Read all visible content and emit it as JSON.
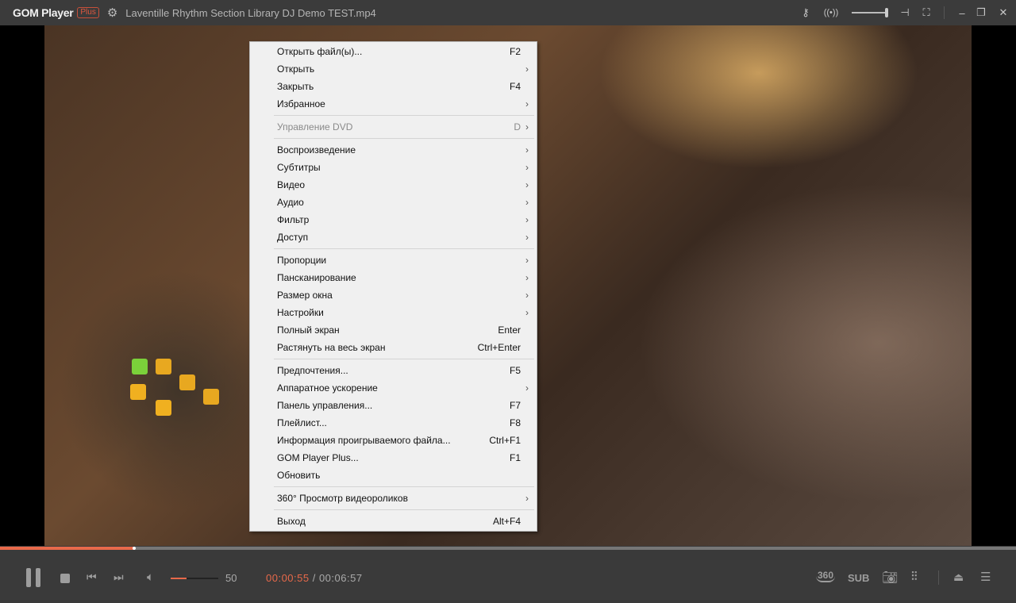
{
  "app": {
    "logo": "GOM Player",
    "logo_badge": "Plus",
    "file_title": "Laventille Rhythm Section Library DJ Demo TEST.mp4"
  },
  "titlebar_icons": [
    "settings-gear-icon",
    "key-icon",
    "broadcast-icon",
    "opacity-slider",
    "pin-icon",
    "fullscreen-icon",
    "minimize-icon",
    "restore-icon",
    "close-icon"
  ],
  "menu": [
    {
      "label": "Открыть файл(ы)...",
      "shortcut": "F2"
    },
    {
      "label": "Открыть",
      "submenu": true
    },
    {
      "label": "Закрыть",
      "shortcut": "F4"
    },
    {
      "label": "Избранное",
      "submenu": true
    },
    {
      "separator": true
    },
    {
      "label": "Управление DVD",
      "shortcut": "D",
      "submenu": true,
      "disabled": true
    },
    {
      "separator": true
    },
    {
      "label": "Воспроизведение",
      "submenu": true
    },
    {
      "label": "Субтитры",
      "submenu": true
    },
    {
      "label": "Видео",
      "submenu": true
    },
    {
      "label": "Аудио",
      "submenu": true
    },
    {
      "label": "Фильтр",
      "submenu": true
    },
    {
      "label": "Доступ",
      "submenu": true
    },
    {
      "separator": true
    },
    {
      "label": "Пропорции",
      "submenu": true
    },
    {
      "label": "Пансканирование",
      "submenu": true
    },
    {
      "label": "Размер окна",
      "submenu": true
    },
    {
      "label": "Настройки",
      "submenu": true
    },
    {
      "label": "Полный экран",
      "shortcut": "Enter"
    },
    {
      "label": "Растянуть на весь экран",
      "shortcut": "Ctrl+Enter"
    },
    {
      "separator": true
    },
    {
      "label": "Предпочтения...",
      "shortcut": "F5"
    },
    {
      "label": "Аппаратное ускорение",
      "submenu": true
    },
    {
      "label": "Панель управления...",
      "shortcut": "F7"
    },
    {
      "label": "Плейлист...",
      "shortcut": "F8"
    },
    {
      "label": "Информация проигрываемого файла...",
      "shortcut": "Ctrl+F1"
    },
    {
      "label": "GOM Player Plus...",
      "shortcut": "F1"
    },
    {
      "label": "Обновить"
    },
    {
      "separator": true
    },
    {
      "label": "360° Просмотр видеороликов",
      "submenu": true
    },
    {
      "separator": true
    },
    {
      "label": "Выход",
      "shortcut": "Alt+F4"
    }
  ],
  "playback": {
    "progress_percent": 13.2,
    "volume": 50,
    "current_time": "00:00:55",
    "separator": " / ",
    "total_time": "00:06:57",
    "label_360": "360",
    "label_sub": "SUB"
  },
  "colors": {
    "accent": "#e8694a",
    "titlebar": "#3b3b3b",
    "menu_bg": "#f0f0f0"
  }
}
